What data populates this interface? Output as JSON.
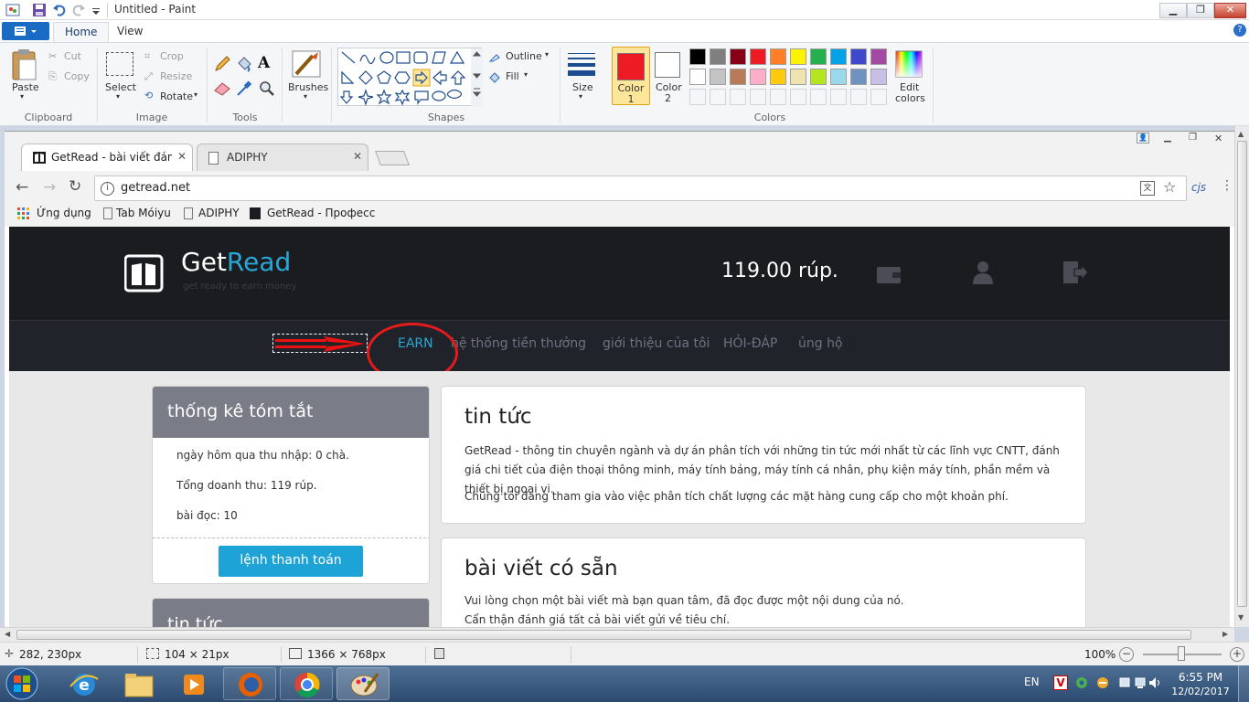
{
  "paint": {
    "window_title": "Untitled - Paint",
    "tabs": {
      "home": "Home",
      "view": "View"
    },
    "clipboard": {
      "paste": "Paste",
      "cut": "Cut",
      "copy": "Copy",
      "label": "Clipboard"
    },
    "image": {
      "select": "Select",
      "crop": "Crop",
      "resize": "Resize",
      "rotate": "Rotate",
      "label": "Image"
    },
    "tools_label": "Tools",
    "brushes": "Brushes",
    "shapes": {
      "outline": "Outline",
      "fill": "Fill",
      "label": "Shapes"
    },
    "size": "Size",
    "color1": {
      "line1": "Color",
      "line2": "1"
    },
    "color2": {
      "line1": "Color",
      "line2": "2"
    },
    "edit_colors": {
      "line1": "Edit",
      "line2": "colors"
    },
    "colors_label": "Colors",
    "palette_row1": [
      "#000000",
      "#7f7f7f",
      "#880015",
      "#ed1c24",
      "#ff7f27",
      "#fff200",
      "#22b14c",
      "#00a2e8",
      "#3f48cc",
      "#a349a4"
    ],
    "palette_row2": [
      "#ffffff",
      "#c3c3c3",
      "#b97a57",
      "#ffaec9",
      "#ffc90e",
      "#efe4b0",
      "#b5e61d",
      "#99d9ea",
      "#7092be",
      "#c8bfe7"
    ],
    "color1_value": "#ed1c24",
    "color2_value": "#ffffff",
    "status": {
      "cursor": "282, 230px",
      "selection": "104 × 21px",
      "image_size": "1366 × 768px",
      "zoom": "100%"
    }
  },
  "browser": {
    "tabs": [
      {
        "title": "GetRead - bài viết đánh g"
      },
      {
        "title": "ADIPHY"
      }
    ],
    "url": "getread.net",
    "bookmarks": {
      "apps": "Ứng dụng",
      "tab_moiyu": "Tab Móiyu",
      "adiphy": "ADIPHY",
      "getread": "GetRead - Професси"
    },
    "extension": "cjs"
  },
  "site": {
    "logo_get": "Get",
    "logo_read": "Read",
    "tagline": "get ready to earn money",
    "balance": "119.00 rúp.",
    "nav": {
      "earn": "EARN",
      "rewards": "hệ thống tiền thưởng",
      "referral": "giới thiệu của tôi",
      "faq": "HỎI-ĐÁP",
      "support": "ủng hộ"
    },
    "summary": {
      "title": "thống kê tóm tắt",
      "yesterday": "ngày hôm qua thu nhập: 0 chà.",
      "total": "Tổng doanh thu: 119 rúp.",
      "articles": "bài đọc: 10",
      "button": "lệnh thanh toán"
    },
    "news_side_title": "tin tức",
    "news": {
      "title": "tin tức",
      "p1": "GetRead - thông tin chuyên ngành và dự án phân tích với những tin tức mới nhất từ các lĩnh vực CNTT, đánh giá chi tiết của điện thoại thông minh, máy tính bảng, máy tính cá nhân, phụ kiện máy tính, phần mềm và thiết bị ngoại vi.",
      "p2": "Chúng tôi đang tham gia vào việc phân tích chất lượng các mặt hàng cung cấp cho một khoản phí."
    },
    "articles": {
      "title": "bài viết có sẵn",
      "p1": "Vui lòng chọn một bài viết mà bạn quan tâm, đã đọc được một nội dung của nó.",
      "p2": "Cẩn thận đánh giá tất cả bài viết gửi về tiêu chí."
    },
    "accent": "#29a8d8",
    "button_color": "#1ea3d6"
  },
  "taskbar": {
    "lang": "EN",
    "time": "6:55 PM",
    "date": "12/02/2017"
  }
}
